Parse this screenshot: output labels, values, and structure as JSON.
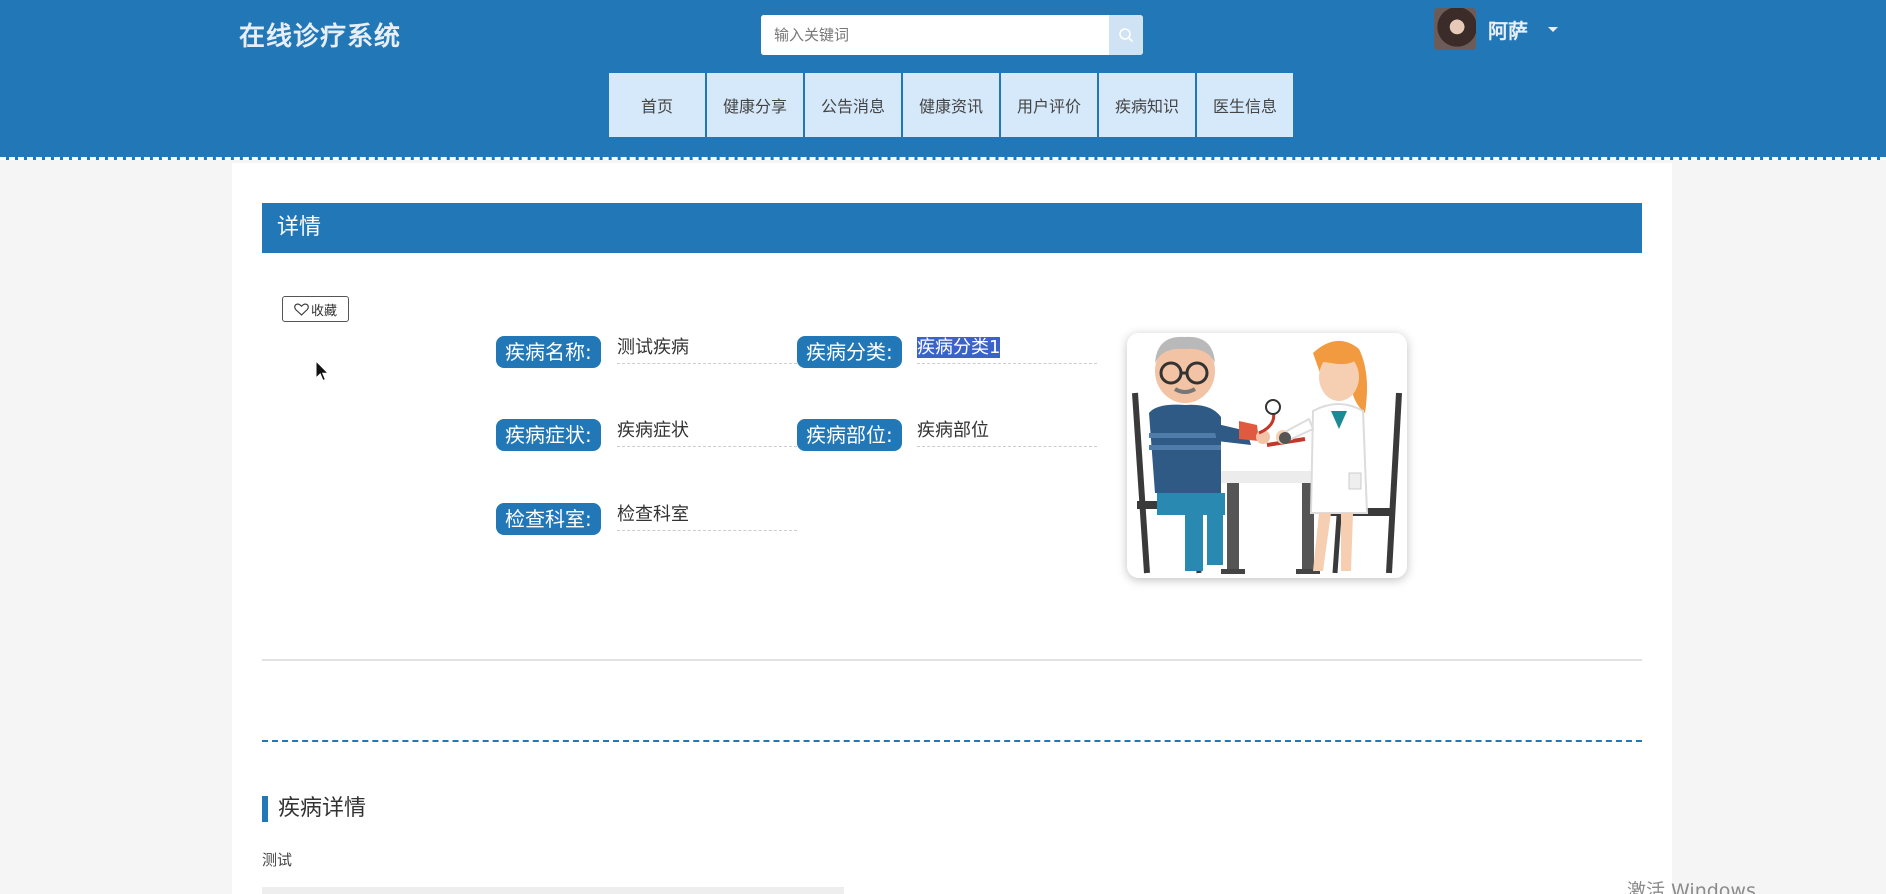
{
  "header": {
    "logo": "在线诊疗系统",
    "search": {
      "placeholder": "输入关键词"
    },
    "user": {
      "name": "阿萨"
    }
  },
  "nav": {
    "items": [
      {
        "label": "首页"
      },
      {
        "label": "健康分享"
      },
      {
        "label": "公告消息"
      },
      {
        "label": "健康资讯"
      },
      {
        "label": "用户评价"
      },
      {
        "label": "疾病知识"
      },
      {
        "label": "医生信息"
      }
    ]
  },
  "detail": {
    "title": "详情",
    "favorite_label": "收藏",
    "fields": {
      "name": {
        "label": "疾病名称:",
        "value": "测试疾病"
      },
      "category": {
        "label": "疾病分类:",
        "value": "疾病分类1"
      },
      "symptom": {
        "label": "疾病症状:",
        "value": "疾病症状"
      },
      "position": {
        "label": "疾病部位:",
        "value": "疾病部位"
      },
      "department": {
        "label": "检查科室:",
        "value": "检查科室"
      }
    }
  },
  "section": {
    "title": "疾病详情",
    "text": "测试"
  },
  "watermark": "激活 Windows",
  "colors": {
    "primary": "#2277b7",
    "nav_bg": "#d6e9fa",
    "highlight": "#3a62c9"
  },
  "icons": {
    "search": "search-icon",
    "favorite": "heart-icon",
    "user_menu": "chevron-down-icon"
  }
}
